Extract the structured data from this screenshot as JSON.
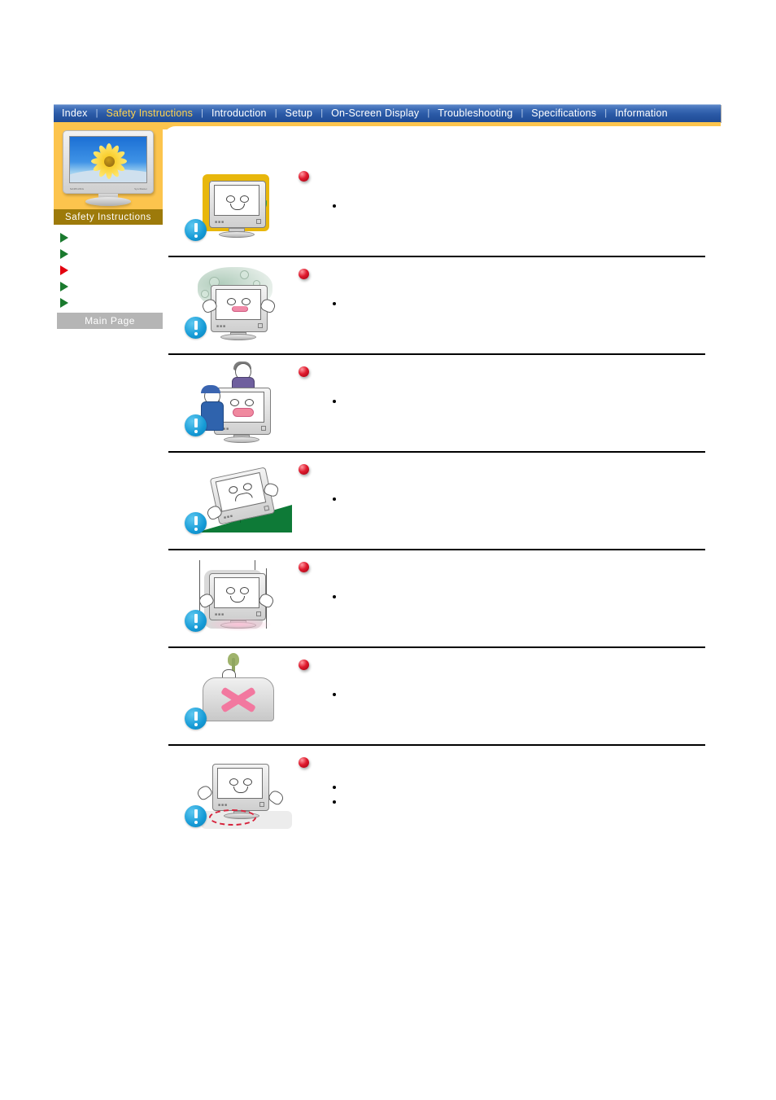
{
  "nav": {
    "separator": "|",
    "items": [
      {
        "label": "Index",
        "active": false
      },
      {
        "label": "Safety Instructions",
        "active": true
      },
      {
        "label": "Introduction",
        "active": false
      },
      {
        "label": "Setup",
        "active": false
      },
      {
        "label": "On-Screen Display",
        "active": false
      },
      {
        "label": "Troubleshooting",
        "active": false
      },
      {
        "label": "Specifications",
        "active": false
      },
      {
        "label": "Information",
        "active": false
      }
    ]
  },
  "sidebar": {
    "title": "Safety Instructions",
    "thumbnail": {
      "brand": "SAMSUNG",
      "model": "SyncMaster",
      "icon": "monitor-sunflower-thumbnail"
    },
    "menu_items": [
      {
        "label": "",
        "marker_color": "#1a7a2e",
        "icon": "triangle-bullet-green"
      },
      {
        "label": "",
        "marker_color": "#1a7a2e",
        "icon": "triangle-bullet-green"
      },
      {
        "label": "",
        "marker_color": "#e3000f",
        "icon": "triangle-bullet-red"
      },
      {
        "label": "",
        "marker_color": "#1a7a2e",
        "icon": "triangle-bullet-green"
      },
      {
        "label": "",
        "marker_color": "#1a7a2e",
        "icon": "triangle-bullet-green"
      }
    ],
    "main_page_button": "Main Page"
  },
  "colors": {
    "nav_gradient_top": "#5b86c8",
    "nav_gradient_bottom": "#1f4b95",
    "nav_active_text": "#ffd24d",
    "orange_band": "#fcc44d",
    "sidebar_title_bar": "#9d7a0a",
    "main_page_button": "#b5b5b5",
    "warning_badge": "#159ad6",
    "heading_bullet": "#e01b2e",
    "menu_marker_green": "#1a7a2e",
    "menu_marker_red": "#e3000f"
  },
  "content": {
    "rows": [
      {
        "figure": "monitor-behind-curtain",
        "warning_icon": "exclamation-badge",
        "heading_icon": "red-sphere-bullet",
        "heading": "",
        "bullets": [
          ""
        ]
      },
      {
        "figure": "monitor-in-hot-humid-place",
        "warning_icon": "exclamation-badge",
        "heading_icon": "red-sphere-bullet",
        "heading": "",
        "bullets": [
          ""
        ]
      },
      {
        "figure": "two-people-moving-monitor",
        "warning_icon": "exclamation-badge",
        "heading_icon": "red-sphere-bullet",
        "heading": "",
        "bullets": [
          ""
        ]
      },
      {
        "figure": "monitor-on-unstable-slope",
        "warning_icon": "exclamation-badge",
        "heading_icon": "red-sphere-bullet",
        "heading": "",
        "bullets": [
          ""
        ]
      },
      {
        "figure": "monitor-dropped-shock",
        "warning_icon": "exclamation-badge",
        "heading_icon": "red-sphere-bullet",
        "heading": "",
        "bullets": [
          ""
        ]
      },
      {
        "figure": "monitor-covered-with-cloth-x",
        "warning_icon": "exclamation-badge",
        "heading_icon": "red-sphere-bullet",
        "heading": "",
        "bullets": [
          ""
        ]
      },
      {
        "figure": "monitor-near-edge-of-table",
        "warning_icon": "exclamation-badge",
        "heading_icon": "red-sphere-bullet",
        "heading": "",
        "bullets": [
          "",
          ""
        ]
      }
    ]
  }
}
